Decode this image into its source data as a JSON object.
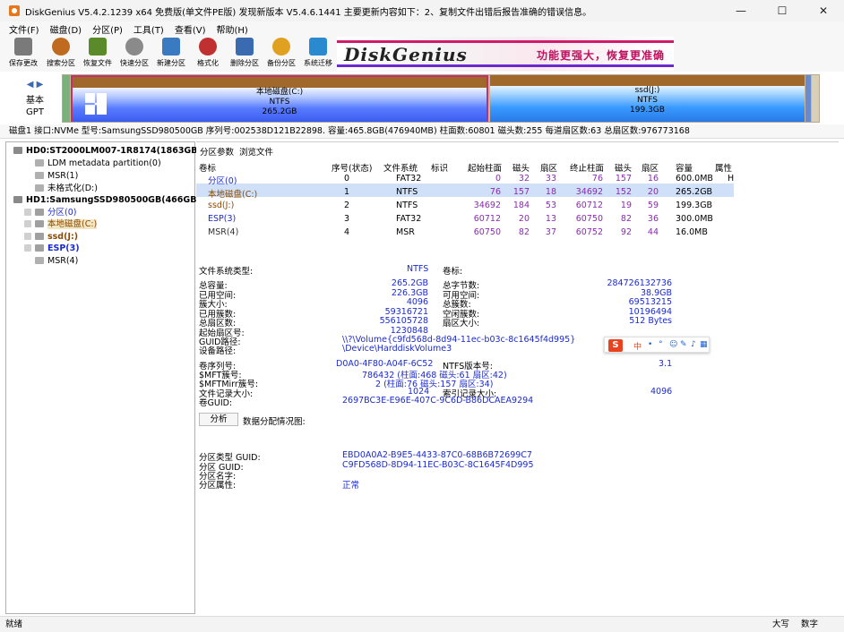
{
  "window": {
    "title": "DiskGenius V5.4.2.1239 x64 免费版(单文件PE版)   发现新版本 V5.4.6.1441   主要更新内容如下：2、复制文件出错后报告准确的错误信息。",
    "minimize": "—",
    "maximize": "☐",
    "close": "✕"
  },
  "menu": [
    "文件(F)",
    "磁盘(D)",
    "分区(P)",
    "工具(T)",
    "查看(V)",
    "帮助(H)"
  ],
  "toolbar": [
    {
      "label": "保存更改",
      "icon": "save-icon",
      "color": "#7a7a7a"
    },
    {
      "label": "搜索分区",
      "icon": "magnifier-icon",
      "color": "#c06a20"
    },
    {
      "label": "恢复文件",
      "icon": "recover-icon",
      "color": "#5a8a2a"
    },
    {
      "label": "快速分区",
      "icon": "disk-icon",
      "color": "#8a8a8a"
    },
    {
      "label": "新建分区",
      "icon": "new-partition-icon",
      "color": "#3a7ac0"
    },
    {
      "label": "格式化",
      "icon": "format-icon",
      "color": "#c03030"
    },
    {
      "label": "删除分区",
      "icon": "trash-icon",
      "color": "#3a6ab0"
    },
    {
      "label": "备份分区",
      "icon": "backup-icon",
      "color": "#e0a020"
    },
    {
      "label": "系统迁移",
      "icon": "migrate-icon",
      "color": "#2a8ad0"
    }
  ],
  "banner": {
    "logo": "DiskGenius",
    "ad": "功能更强大，恢复更准确"
  },
  "disk_nav": {
    "line1": "基本",
    "line2": "GPT"
  },
  "disk_segments": [
    {
      "name": "本地磁盘(C:)",
      "fs": "NTFS",
      "size": "265.2GB"
    },
    {
      "name": "ssd(J:)",
      "fs": "NTFS",
      "size": "199.3GB"
    }
  ],
  "disk_info": "磁盘1 接口:NVMe  型号:SamsungSSD980500GB  序列号:002538D121B22898.  容量:465.8GB(476940MB)  柱面数:60801  磁头数:255  每道扇区数:63  总扇区数:976773168",
  "tree": [
    {
      "label": "HD0:ST2000LM007-1R8174(1863GB)",
      "bold": true
    },
    {
      "label": "LDM metadata partition(0)"
    },
    {
      "label": "MSR(1)"
    },
    {
      "label": "未格式化(D:)"
    },
    {
      "label": "HD1:SamsungSSD980500GB(466GB)",
      "bold": true
    },
    {
      "label": "分区(0)"
    },
    {
      "label": "本地磁盘(C:)"
    },
    {
      "label": "ssd(J:)"
    },
    {
      "label": "ESP(3)"
    },
    {
      "label": "MSR(4)"
    }
  ],
  "tabs": [
    "分区参数",
    "浏览文件"
  ],
  "ptable": {
    "headers": [
      "卷标",
      "序号(状态)",
      "文件系统",
      "标识",
      "起始柱面",
      "磁头",
      "扇区",
      "终止柱面",
      "磁头",
      "扇区",
      "容量",
      "属性"
    ],
    "rows": [
      [
        "分区(0)",
        "0",
        "FAT32",
        "",
        "0",
        "32",
        "33",
        "76",
        "157",
        "16",
        "600.0MB",
        "H"
      ],
      [
        "本地磁盘(C:)",
        "1",
        "NTFS",
        "",
        "76",
        "157",
        "18",
        "34692",
        "152",
        "20",
        "265.2GB",
        ""
      ],
      [
        "ssd(J:)",
        "2",
        "NTFS",
        "",
        "34692",
        "184",
        "53",
        "60712",
        "19",
        "59",
        "199.3GB",
        ""
      ],
      [
        "ESP(3)",
        "3",
        "FAT32",
        "",
        "60712",
        "20",
        "13",
        "60750",
        "82",
        "36",
        "300.0MB",
        ""
      ],
      [
        "MSR(4)",
        "4",
        "MSR",
        "",
        "60750",
        "82",
        "37",
        "60752",
        "92",
        "44",
        "16.0MB",
        ""
      ]
    ]
  },
  "details": {
    "fs_type_label": "文件系统类型:",
    "fs_type": "NTFS",
    "vol_label_label": "卷标:",
    "left": [
      [
        "总容量:",
        "265.2GB"
      ],
      [
        "已用空间:",
        "226.3GB"
      ],
      [
        "簇大小:",
        "4096"
      ],
      [
        "已用簇数:",
        "59316721"
      ],
      [
        "总扇区数:",
        "556105728"
      ],
      [
        "起始扇区号:",
        "1230848"
      ]
    ],
    "right": [
      [
        "总字节数:",
        "284726132736"
      ],
      [
        "可用空间:",
        "38.9GB"
      ],
      [
        "总簇数:",
        "69513215"
      ],
      [
        "空闲簇数:",
        "10196494"
      ],
      [
        "扇区大小:",
        "512 Bytes"
      ]
    ],
    "guid_path_label": "GUID路径:",
    "guid_path": "\\\\?\\Volume{c9fd568d-8d94-11ec-b03c-8c1645f4d995}",
    "device_path_label": "设备路径:",
    "device_path": "\\Device\\HarddiskVolume3",
    "serial_label": "卷序列号:",
    "serial": "D0A0-4F80-A04F-6C52",
    "ntfs_ver_label": "NTFS版本号:",
    "ntfs_ver": "3.1",
    "mft_label": "$MFT簇号:",
    "mft": "786432 (柱面:468 磁头:61 扇区:42)",
    "mftmirr_label": "$MFTMirr簇号:",
    "mftmirr": "2 (柱面:76 磁头:157 扇区:34)",
    "frs_label": "文件记录大小:",
    "frs": "1024",
    "idx_label": "索引记录大小:",
    "idx": "4096",
    "volguid_label": "卷GUID:",
    "volguid": "2697BC3E-E96E-407C-9C6D-B86DCAEA9294",
    "analyze": "分析",
    "alloc_label": "数据分配情况图:",
    "ptype_guid_label": "分区类型 GUID:",
    "ptype_guid": "EBD0A0A2-B9E5-4433-87C0-68B6B72699C7",
    "part_guid_label": "分区 GUID:",
    "part_guid": "C9FD568D-8D94-11EC-B03C-8C1645F4D995",
    "part_name_label": "分区名字:",
    "part_attr_label": "分区属性:",
    "part_attr": "正常"
  },
  "ime": {
    "logo": "S",
    "glyphs": [
      "中",
      "•",
      "°",
      "☺",
      "✎",
      "♪",
      "▦"
    ]
  },
  "status": {
    "left": "就绪",
    "caps": "大写",
    "num": "数字"
  }
}
